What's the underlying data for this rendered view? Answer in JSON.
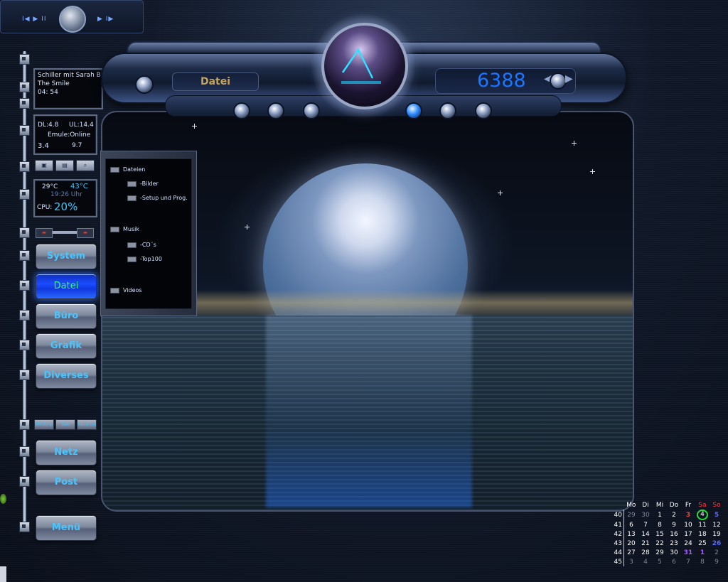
{
  "player": {
    "left_buttons": "I◀ ▶ II",
    "right_buttons": "▶ I▶"
  },
  "music_panel": {
    "line1": "Schiller mit Sarah Br",
    "line2": "The Smile",
    "line3": "04: 54"
  },
  "net_panel": {
    "dl": "DL:4.8",
    "ul": "UL:14.4",
    "emule": "Emule:Online",
    "val1": "3.4",
    "val2": "9.7"
  },
  "temp_panel": {
    "temp1": "29°C",
    "temp2": "43°C",
    "time": "19:26 Uhr",
    "cpu_label": "CPU:",
    "cpu_value": "20%"
  },
  "console": {
    "lcd_left": "Datei",
    "counter": "6388",
    "arrow_left": "◀",
    "arrow_right": "▶"
  },
  "menu": {
    "system": "System",
    "datei": "Datei",
    "buero": "Büro",
    "grafik": "Grafik",
    "diverses": "Diverses",
    "netz": "Netz",
    "post": "Post",
    "menue": "Menü"
  },
  "small_buttons": [
    "WinAmp",
    "Task",
    "Sanarize"
  ],
  "tree": {
    "dateien": "Dateien",
    "bilder": "-Bilder",
    "setup": "-Setup und Prog.",
    "musik": "Musik",
    "cds": "-CD´s",
    "top100": "-Top100",
    "videos": "Videos"
  },
  "calendar": {
    "headers": [
      "Mo",
      "Di",
      "Mi",
      "Do",
      "Fr",
      "Sa",
      "So"
    ],
    "weeks": [
      {
        "wk": "40",
        "days": [
          "29",
          "30",
          "1",
          "2",
          "3",
          "4",
          "5"
        ]
      },
      {
        "wk": "41",
        "days": [
          "6",
          "7",
          "8",
          "9",
          "10",
          "11",
          "12"
        ]
      },
      {
        "wk": "42",
        "days": [
          "13",
          "14",
          "15",
          "16",
          "17",
          "18",
          "19"
        ]
      },
      {
        "wk": "43",
        "days": [
          "20",
          "21",
          "22",
          "23",
          "24",
          "25",
          "26"
        ]
      },
      {
        "wk": "44",
        "days": [
          "27",
          "28",
          "29",
          "30",
          "31",
          "1",
          "2"
        ]
      },
      {
        "wk": "45",
        "days": [
          "3",
          "4",
          "5",
          "6",
          "7",
          "8",
          "9"
        ]
      }
    ]
  },
  "colors": {
    "accent": "#37c8ff",
    "active_button": "#1c4dff",
    "counter": "#1d74ff",
    "today_ring": "#2adb3a"
  }
}
